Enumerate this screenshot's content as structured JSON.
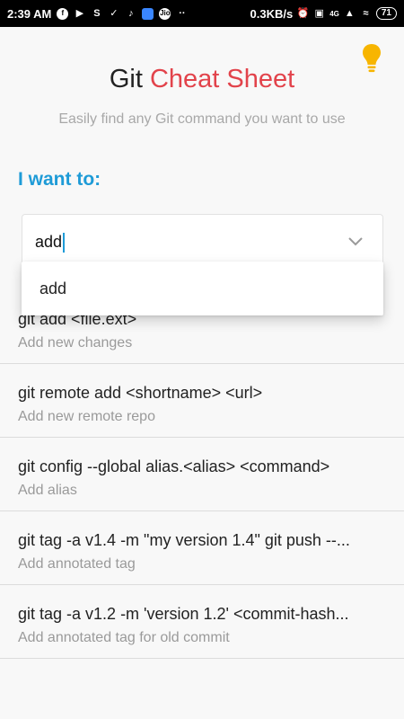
{
  "status_bar": {
    "time": "2:39 AM",
    "network_speed": "0.3KB/s",
    "network_type": "4G",
    "battery": "71",
    "jio_label": "Jio"
  },
  "app": {
    "title_part1": "Git",
    "title_part2": "Cheat Sheet",
    "subtitle": "Easily find any Git command you want to use",
    "i_want_to": "I want to:",
    "accent_color": "#e2434b",
    "link_color": "#1e9bd7"
  },
  "search": {
    "value": "add",
    "dropdown_options": [
      "add"
    ]
  },
  "results": [
    {
      "command": "git add <file.ext>",
      "description": "Add new changes"
    },
    {
      "command": "git remote add <shortname> <url>",
      "description": "Add new remote repo"
    },
    {
      "command": "git config --global alias.<alias> <command>",
      "description": "Add alias"
    },
    {
      "command": "git tag -a v1.4 -m \"my version 1.4\"  git push --...",
      "description": "Add annotated tag"
    },
    {
      "command": "git tag -a v1.2 -m 'version 1.2' <commit-hash...",
      "description": "Add annotated tag for old commit"
    }
  ],
  "icons": {
    "bulb": "lightbulb-icon",
    "chevron": "chevron-down-icon"
  }
}
